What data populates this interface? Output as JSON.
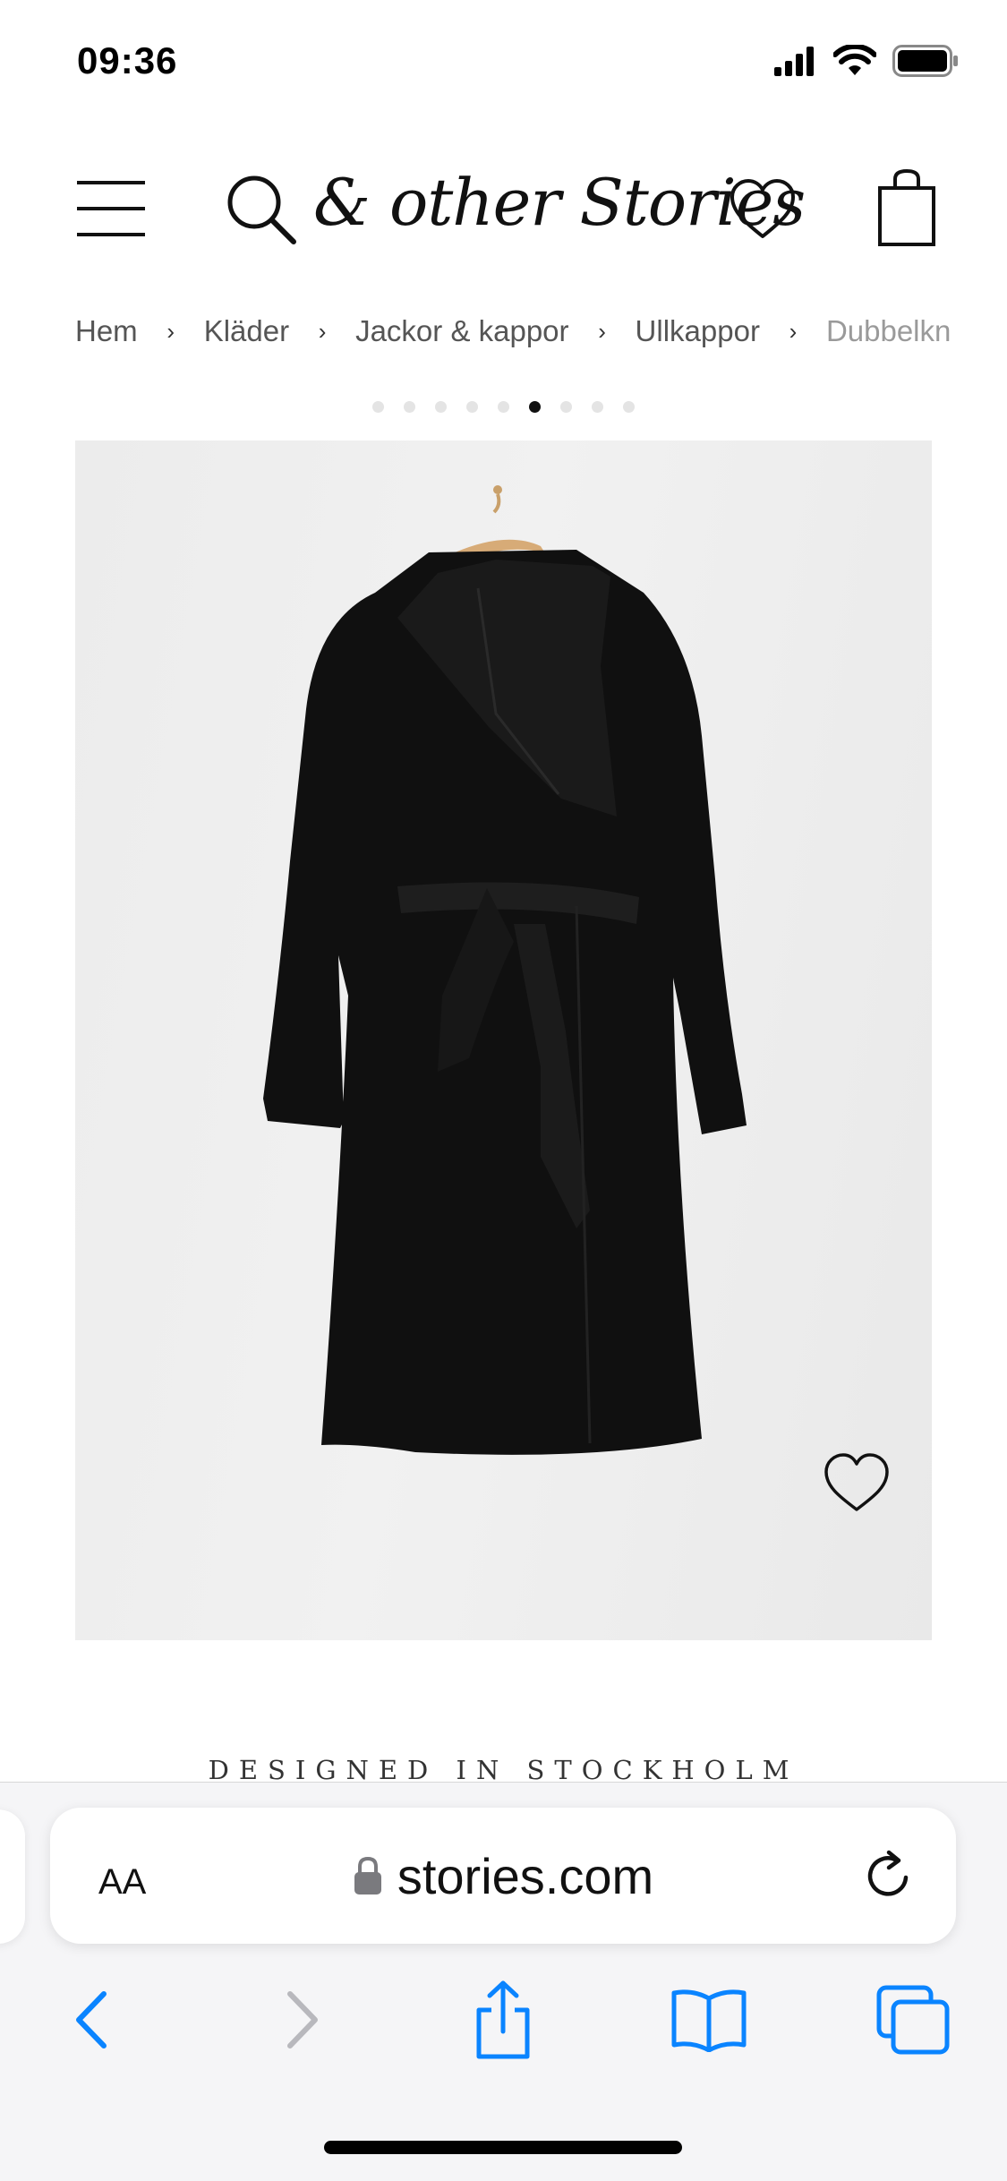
{
  "status_bar": {
    "time": "09:36",
    "icons": [
      "cellular-signal-icon",
      "wifi-icon",
      "battery-icon"
    ]
  },
  "header": {
    "logo_text": "& other Stories",
    "icons": [
      "menu-icon",
      "search-icon",
      "heart-icon",
      "shopping-bag-icon"
    ]
  },
  "breadcrumb": {
    "items": [
      "Hem",
      "Kläder",
      "Jackor & kappor",
      "Ullkappor",
      "Dubbelkn"
    ],
    "separator": "›"
  },
  "carousel": {
    "total_images": 9,
    "active_index": 5
  },
  "product": {
    "image_alt": "Black belted wrap coat on wooden hanger",
    "wishlist_icon": "heart-icon"
  },
  "tagline": "DESIGNED IN STOCKHOLM",
  "browser": {
    "text_size_label": "AA",
    "url": "stories.com",
    "toolbar_icons": [
      "back-icon",
      "forward-icon",
      "share-icon",
      "bookmarks-icon",
      "tabs-icon"
    ],
    "accent_color": "#0a84ff",
    "disabled_color": "#b8b8bd"
  }
}
